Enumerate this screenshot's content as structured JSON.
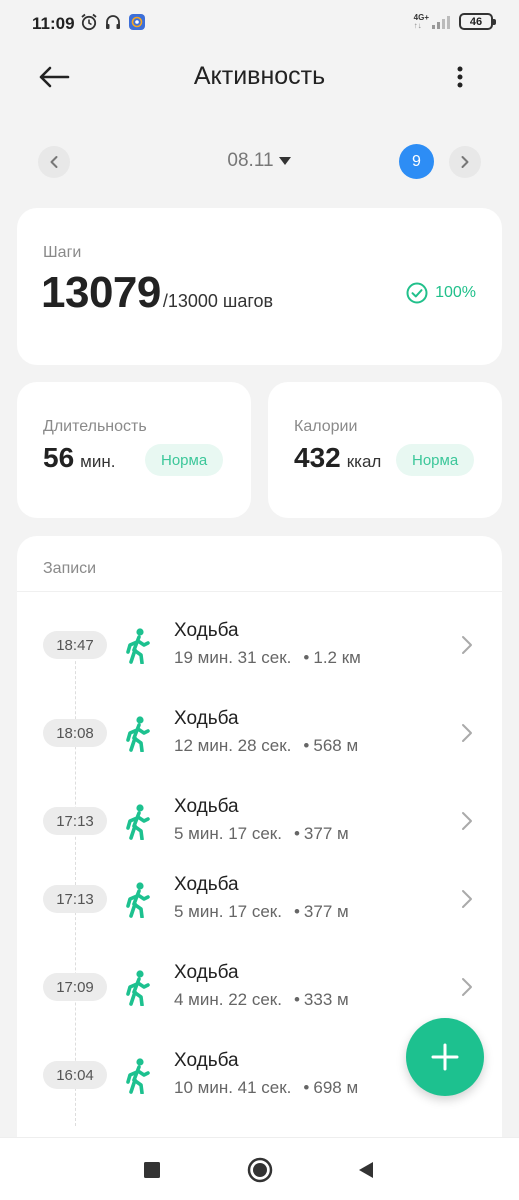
{
  "status_bar": {
    "time": "11:09",
    "network_label_top": "4G+",
    "network_label_bottom": "↑↓",
    "battery": "46"
  },
  "header": {
    "title": "Активность"
  },
  "date_nav": {
    "date": "08.11",
    "day_badge": "9"
  },
  "steps": {
    "label": "Шаги",
    "value": "13079",
    "goal": "/13000 шагов",
    "percent": "100%"
  },
  "duration": {
    "label": "Длительность",
    "value": "56",
    "unit": "мин.",
    "status": "Норма"
  },
  "calories": {
    "label": "Калории",
    "value": "432",
    "unit": "ккал",
    "status": "Норма"
  },
  "records": {
    "title": "Записи",
    "items": [
      {
        "time": "18:47",
        "type": "Ходьба",
        "duration": "19 мин. 31 сек.",
        "distance": "1.2 км"
      },
      {
        "time": "18:08",
        "type": "Ходьба",
        "duration": "12 мин. 28 сек.",
        "distance": "568 м"
      },
      {
        "time": "17:13",
        "type": "Ходьба",
        "duration": "5 мин. 17 сек.",
        "distance": "377 м"
      },
      {
        "time": "17:13",
        "type": "Ходьба",
        "duration": "5 мин. 17 сек.",
        "distance": "377 м"
      },
      {
        "time": "17:09",
        "type": "Ходьба",
        "duration": "4 мин. 22 сек.",
        "distance": "333 м"
      },
      {
        "time": "16:04",
        "type": "Ходьба",
        "duration": "10 мин. 41 сек.",
        "distance": "698 м"
      }
    ]
  },
  "colors": {
    "accent_green": "#1dc18f",
    "badge_blue": "#2d8df5",
    "background": "#f3f3f3"
  },
  "icons": {
    "back": "arrow-left-icon",
    "more": "more-vertical-icon",
    "check": "check-circle-icon",
    "walk": "walking-person-icon",
    "add": "plus-icon"
  }
}
